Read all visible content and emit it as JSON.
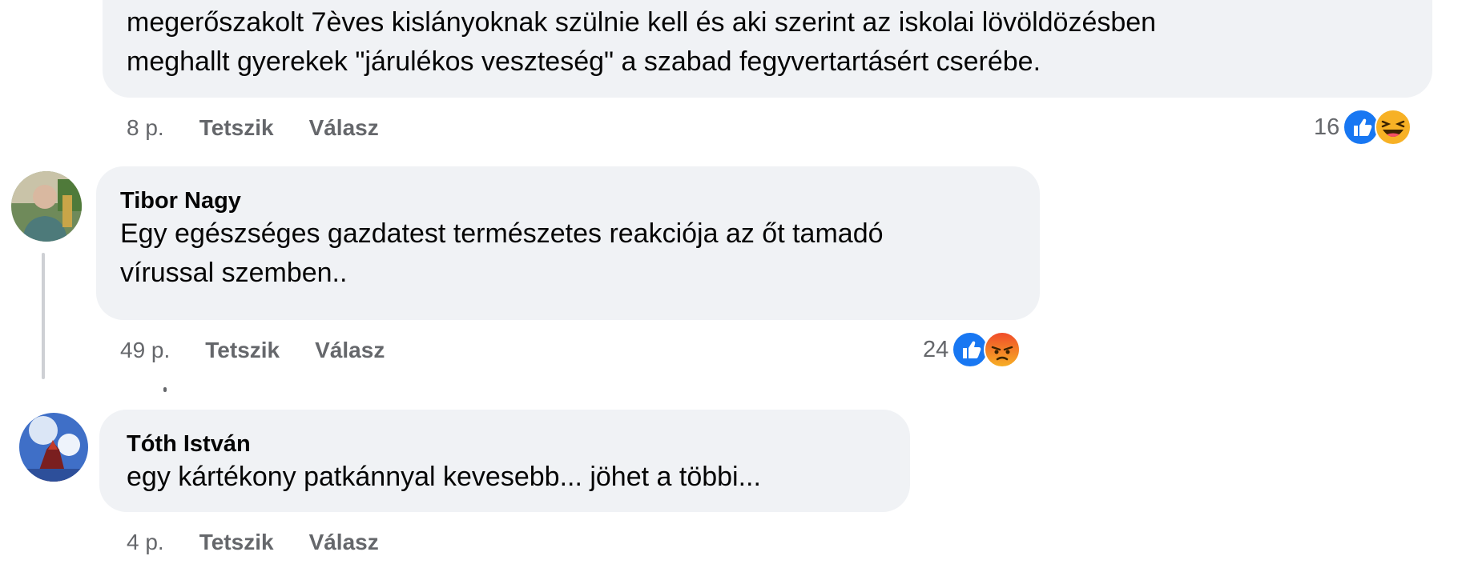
{
  "comment1": {
    "text_line1": "megerőszakolt 7èves kislányoknak szülnie kell és aki szerint az iskolai lövöldözésben",
    "text_line2": "meghallt gyerekek \"járulékos veszteség\" a szabad fegyvertartásért cserébe.",
    "time": "8 p.",
    "like_label": "Tetszik",
    "reply_label": "Válasz",
    "reaction_count": "16",
    "reactions": [
      "like-icon",
      "haha-icon"
    ]
  },
  "comment2": {
    "author": "Tibor Nagy",
    "text_line1": "Egy egészséges gazdatest természetes reakciója az őt tamadó",
    "text_line2": "vírussal szemben..",
    "time": "49 p.",
    "like_label": "Tetszik",
    "reply_label": "Válasz",
    "reaction_count": "24",
    "reactions": [
      "like-icon",
      "angry-icon"
    ]
  },
  "comment3": {
    "author": "Tóth István",
    "text_line1": "egy kártékony patkánnyal kevesebb... jöhet a többi...",
    "time": "4 p.",
    "like_label": "Tetszik",
    "reply_label": "Válasz"
  },
  "colors": {
    "bubble": "#f0f2f5",
    "meta_text": "#65676b",
    "like_blue": "#1877f2",
    "thread_line": "#ced0d4"
  }
}
